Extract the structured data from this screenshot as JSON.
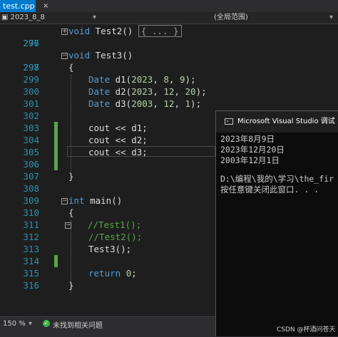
{
  "tab": {
    "label": "test.cpp",
    "close": "×"
  },
  "nav": {
    "scope": "2023_8_8",
    "member": "(全局范围)"
  },
  "editor": {
    "lines": [
      {
        "num": "277",
        "text": "void Test2()",
        "collapsed": "{ ... }"
      },
      {
        "num": "296",
        "text": ""
      },
      {
        "num": "297",
        "text": "void Test3()"
      },
      {
        "num": "298",
        "text": "{"
      },
      {
        "num": "299",
        "text": "Date d1(2023, 8, 9);"
      },
      {
        "num": "300",
        "text": "Date d2(2023, 12, 20);"
      },
      {
        "num": "301",
        "text": "Date d3(2003, 12, 1);"
      },
      {
        "num": "302",
        "text": ""
      },
      {
        "num": "303",
        "text": "cout << d1;"
      },
      {
        "num": "304",
        "text": "cout << d2;"
      },
      {
        "num": "305",
        "text": "cout << d3;"
      },
      {
        "num": "306",
        "text": ""
      },
      {
        "num": "307",
        "text": "}"
      },
      {
        "num": "308",
        "text": ""
      },
      {
        "num": "309",
        "text": "int main()"
      },
      {
        "num": "310",
        "text": "{"
      },
      {
        "num": "311",
        "text": "//Test1();"
      },
      {
        "num": "312",
        "text": "//Test2();"
      },
      {
        "num": "313",
        "text": "Test3();"
      },
      {
        "num": "314",
        "text": ""
      },
      {
        "num": "315",
        "text": "return 0;"
      },
      {
        "num": "316",
        "text": "}"
      }
    ]
  },
  "console": {
    "title": "Microsoft Visual Studio 调试",
    "lines": [
      "2023年8月9日",
      "2023年12月20日",
      "2003年12月1日",
      "",
      "D:\\编程\\我的\\学习\\the_fir",
      "按任意键关闭此窗口. . ."
    ]
  },
  "status": {
    "zoom": "150 %",
    "issues": "未找到相关问题"
  },
  "watermark": "CSDN @杯酒问苍天",
  "colors": {
    "accent": "#007acc",
    "keyword": "#569cd6",
    "number": "#b5cea8",
    "comment": "#57a64a",
    "line_number": "#2b91af"
  }
}
